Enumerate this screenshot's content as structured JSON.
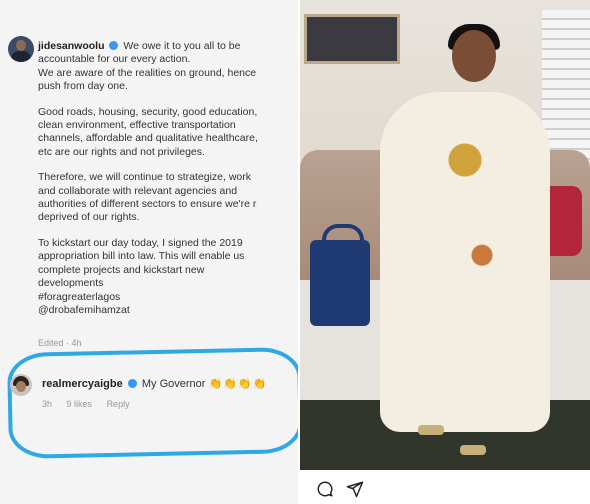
{
  "post": {
    "username": "jidesanwoolu",
    "line1": "We owe it to you all to be",
    "line2": "accountable for our every action.",
    "para1": [
      "We are aware of the realities on ground, hence",
      "push from day one."
    ],
    "para2": [
      "Good roads, housing, security, good education,",
      "clean environment, effective transportation",
      "channels, affordable and qualitative healthcare,",
      "etc are our rights and not privileges."
    ],
    "para3": [
      "Therefore, we will continue to strategize, work",
      "and collaborate with relevant agencies and",
      "authorities of different sectors to ensure we're r",
      "deprived of our rights."
    ],
    "para4": [
      "To kickstart our day today, I signed the 2019",
      "appropriation bill into law. This will enable us",
      "complete projects and kickstart new",
      "developments",
      "#foragreaterlagos",
      "@drobafemihamzat"
    ],
    "edited": "Edited · 4h"
  },
  "comment": {
    "username": "realmercyaigbe",
    "text": "My Governor",
    "claps": "👏👏👏👏",
    "time": "3h",
    "likes": "9 likes",
    "reply": "Reply"
  },
  "colors": {
    "highlight": "#2fa8e6",
    "verified": "#3897f0"
  },
  "icons": {
    "comment": "comment-icon",
    "share": "send-icon"
  }
}
